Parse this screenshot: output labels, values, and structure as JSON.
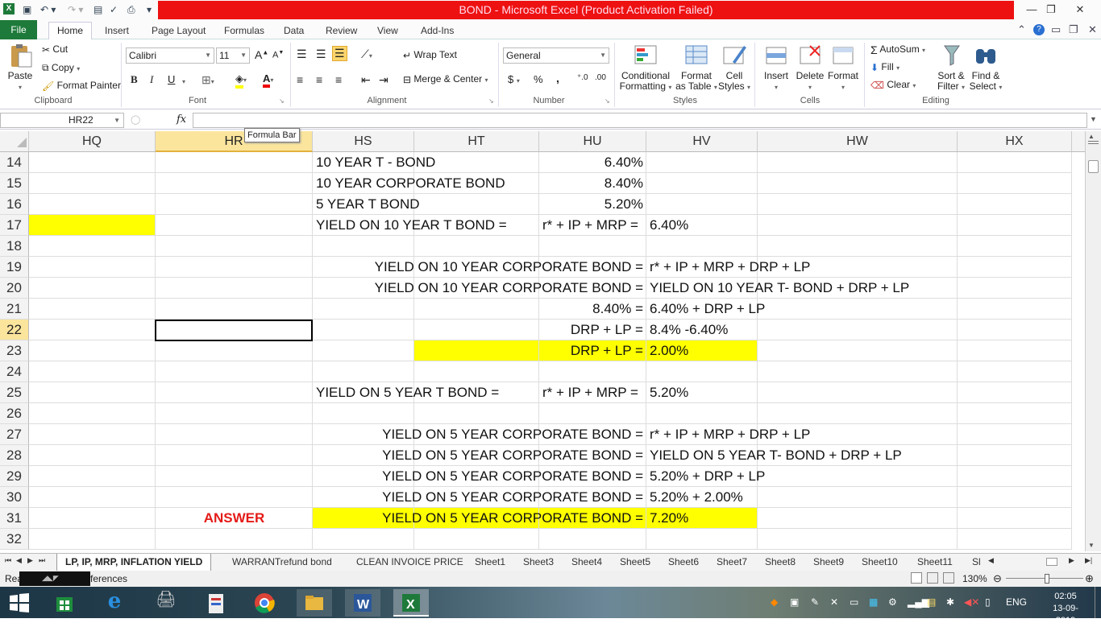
{
  "window": {
    "title": "BOND  -  Microsoft Excel (Product Activation Failed)",
    "min": "—",
    "max": "❐",
    "close": "✕"
  },
  "ribbon_tabs": [
    "File",
    "Home",
    "Insert",
    "Page Layout",
    "Formulas",
    "Data",
    "Review",
    "View",
    "Add-Ins"
  ],
  "clipboard": {
    "paste": "Paste",
    "cut": "Cut",
    "copy": "Copy",
    "format_painter": "Format Painter",
    "label": "Clipboard"
  },
  "font": {
    "name": "Calibri",
    "size": "11",
    "label": "Font",
    "bold": "B",
    "italic": "I",
    "underline": "U"
  },
  "alignment": {
    "wrap": "Wrap Text",
    "merge": "Merge & Center",
    "label": "Alignment"
  },
  "number": {
    "format": "General",
    "currency": "$",
    "percent": "%",
    "comma": ",",
    "label": "Number"
  },
  "styles": {
    "cond_line1": "Conditional",
    "cond_line2": "Formatting",
    "fmt_line1": "Format",
    "fmt_line2": "as Table",
    "cell_line1": "Cell",
    "cell_line2": "Styles",
    "label": "Styles"
  },
  "cells_group": {
    "insert": "Insert",
    "delete": "Delete",
    "format": "Format",
    "label": "Cells"
  },
  "editing": {
    "autosum": "AutoSum",
    "fill": "Fill",
    "clear": "Clear",
    "sort_line1": "Sort &",
    "sort_line2": "Filter",
    "find_line1": "Find &",
    "find_line2": "Select",
    "label": "Editing"
  },
  "formula_bar": {
    "name_box": "HR22",
    "fx": "fx",
    "tooltip": "Formula Bar",
    "content": ""
  },
  "columns": [
    "HQ",
    "HR",
    "HS",
    "HT",
    "HU",
    "HV",
    "HW",
    "HX"
  ],
  "rows": [
    "14",
    "15",
    "16",
    "17",
    "18",
    "19",
    "20",
    "21",
    "22",
    "23",
    "24",
    "25",
    "26",
    "27",
    "28",
    "29",
    "30",
    "31",
    "32"
  ],
  "cells": {
    "hs14": "10 YEAR T - BOND",
    "hu14": "6.40%",
    "hs15": "10 YEAR CORPORATE BOND",
    "hu15": "8.40%",
    "hs16": "5 YEAR T BOND",
    "hu16": "5.20%",
    "hs17": "YIELD ON 10 YEAR T BOND =",
    "hu17": "r* + IP + MRP =",
    "hv17": "6.40%",
    "hu19": "YIELD ON 10 YEAR CORPORATE BOND =",
    "hv19": "r* + IP + MRP + DRP + LP",
    "hu20": "YIELD ON 10 YEAR CORPORATE BOND =",
    "hv20": "YIELD ON 10 YEAR T- BOND + DRP + LP",
    "hu21": "8.40% =",
    "hv21": "6.40% + DRP +  LP",
    "hu22": "DRP + LP =",
    "hv22": "8.4% -6.40%",
    "hu23": "DRP + LP =",
    "hv23": "2.00%",
    "hs25": "YIELD ON 5 YEAR T BOND =",
    "hu25": "r* + IP + MRP =",
    "hv25": "5.20%",
    "hu27": "YIELD ON 5 YEAR CORPORATE BOND =",
    "hv27": "r* + IP + MRP + DRP + LP",
    "hu28": "YIELD ON 5 YEAR CORPORATE BOND =",
    "hv28": "YIELD ON 5 YEAR T- BOND + DRP + LP",
    "hu29": "YIELD ON 5 YEAR CORPORATE BOND =",
    "hv29": "5.20% + DRP +  LP",
    "hu30": "YIELD ON 5 YEAR CORPORATE BOND =",
    "hv30": "5.20% + 2.00%",
    "hr31": "ANSWER",
    "hu31": "YIELD ON 5 YEAR CORPORATE BOND =",
    "hv31": "7.20%"
  },
  "sheet_tabs": [
    "LP, IP, MRP, INFLATION YIELD",
    "WARRANTrefund bond",
    "CLEAN INVOICE PRICE",
    "Sheet1",
    "Sheet3",
    "Sheet4",
    "Sheet5",
    "Sheet6",
    "Sheet7",
    "Sheet8",
    "Sheet9",
    "Sheet10",
    "Sheet11",
    "Sl"
  ],
  "status": {
    "left_a": "Rea",
    "left_b": "ferences",
    "zoom": "130%"
  },
  "taskbar": {
    "lang": "ENG",
    "time": "02:05",
    "date": "13-09-2019"
  },
  "colors": {
    "title_red": "#ee1111",
    "file_green": "#1e7a3a",
    "highlight_yellow": "#ffff00",
    "answer_red": "#e41b17",
    "selected_header": "#fbe59d"
  }
}
